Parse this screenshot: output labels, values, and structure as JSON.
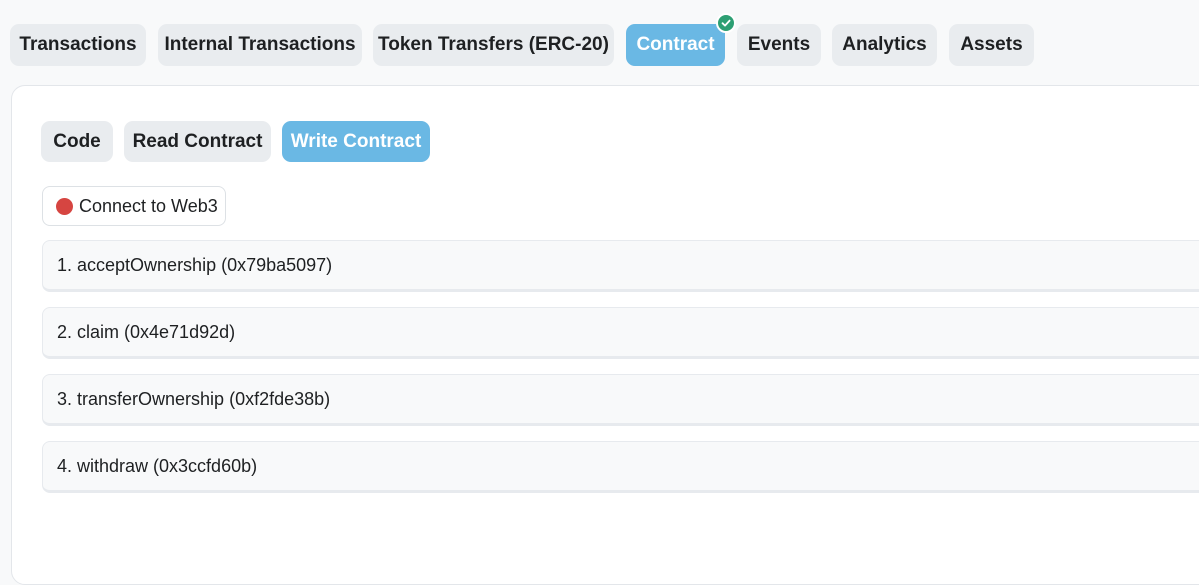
{
  "tabs": [
    {
      "label": "Transactions"
    },
    {
      "label": "Internal Transactions"
    },
    {
      "label": "Token Transfers (ERC-20)"
    },
    {
      "label": "Contract"
    },
    {
      "label": "Events"
    },
    {
      "label": "Analytics"
    },
    {
      "label": "Assets"
    }
  ],
  "active_tab": "Contract",
  "contract_tabs": [
    {
      "label": "Code"
    },
    {
      "label": "Read Contract"
    },
    {
      "label": "Write Contract"
    }
  ],
  "active_contract_tab": "Write Contract",
  "connect": {
    "label": "Connect to Web3",
    "status_color": "#d64541"
  },
  "methods": [
    {
      "label": "1. acceptOwnership (0x79ba5097)"
    },
    {
      "label": "2. claim (0x4e71d92d)"
    },
    {
      "label": "3. transferOwnership (0xf2fde38b)"
    },
    {
      "label": "4. withdraw (0x3ccfd60b)"
    }
  ],
  "colors": {
    "accent": "#6ab8e4",
    "verified": "#2d9f73"
  },
  "icons": {
    "verified": "check-circle-icon"
  }
}
